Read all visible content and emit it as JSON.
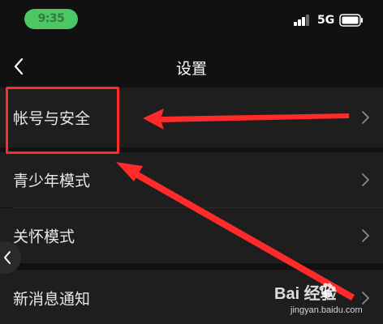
{
  "status_bar": {
    "time": "9:35",
    "network": "5G"
  },
  "nav": {
    "title": "设置",
    "back_icon": "chevron-left-icon"
  },
  "settings": {
    "items": [
      {
        "label": "帐号与安全",
        "icon": "chevron-right-icon"
      },
      {
        "label": "青少年模式",
        "icon": "chevron-right-icon"
      },
      {
        "label": "关怀模式",
        "icon": "chevron-right-icon"
      },
      {
        "label": "新消息通知",
        "icon": "chevron-right-icon"
      }
    ]
  },
  "annotation": {
    "color": "#ff2a2a"
  },
  "watermark": {
    "brand": "Bai 经验",
    "url": "jingyan.baidu.com"
  },
  "colors": {
    "background": "#111111",
    "row": "#1e1e1e",
    "text": "#e8e8e8",
    "time_pill": "#4cc764"
  }
}
